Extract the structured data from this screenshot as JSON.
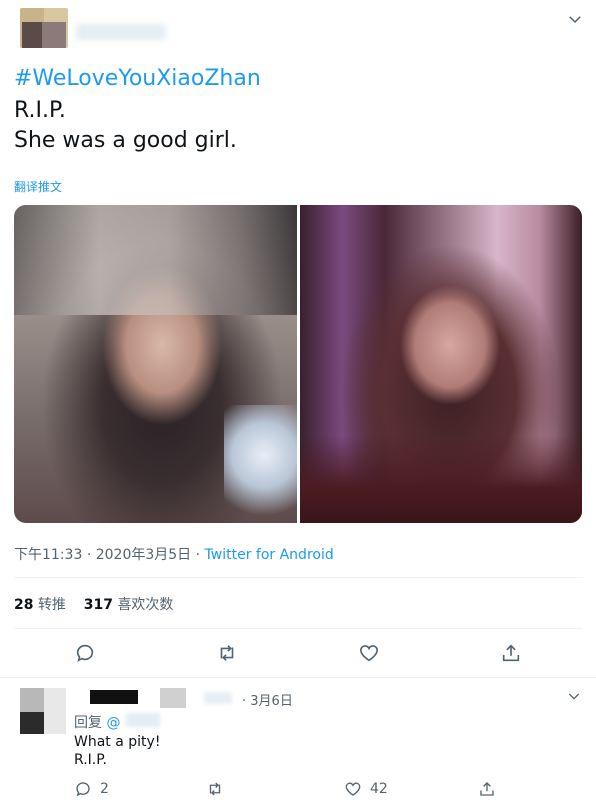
{
  "tweet": {
    "hashtag": "#WeLoveYouXiaoZhan",
    "lines": [
      "R.I.P.",
      "She was a good girl."
    ],
    "translate_label": "翻译推文",
    "time": "下午11:33",
    "date": "2020年3月5日",
    "separator": "·",
    "source": "Twitter for Android",
    "retweets_count": "28",
    "retweets_label": "转推",
    "likes_count": "317",
    "likes_label": "喜欢次数"
  },
  "actions": {
    "reply_icon": "speech-bubble-icon",
    "retweet_icon": "retweet-icon",
    "like_icon": "heart-icon",
    "share_icon": "share-icon"
  },
  "reply": {
    "date": "3月6日",
    "separator": "·",
    "replying_prefix": "回复",
    "replying_at": "@",
    "lines": [
      "What a pity!",
      "R.I.P."
    ],
    "reply_count": "2",
    "like_count": "42"
  },
  "colors": {
    "accent": "#1d9bf0",
    "secondary_text": "#536471",
    "primary_text": "#0f1419"
  }
}
